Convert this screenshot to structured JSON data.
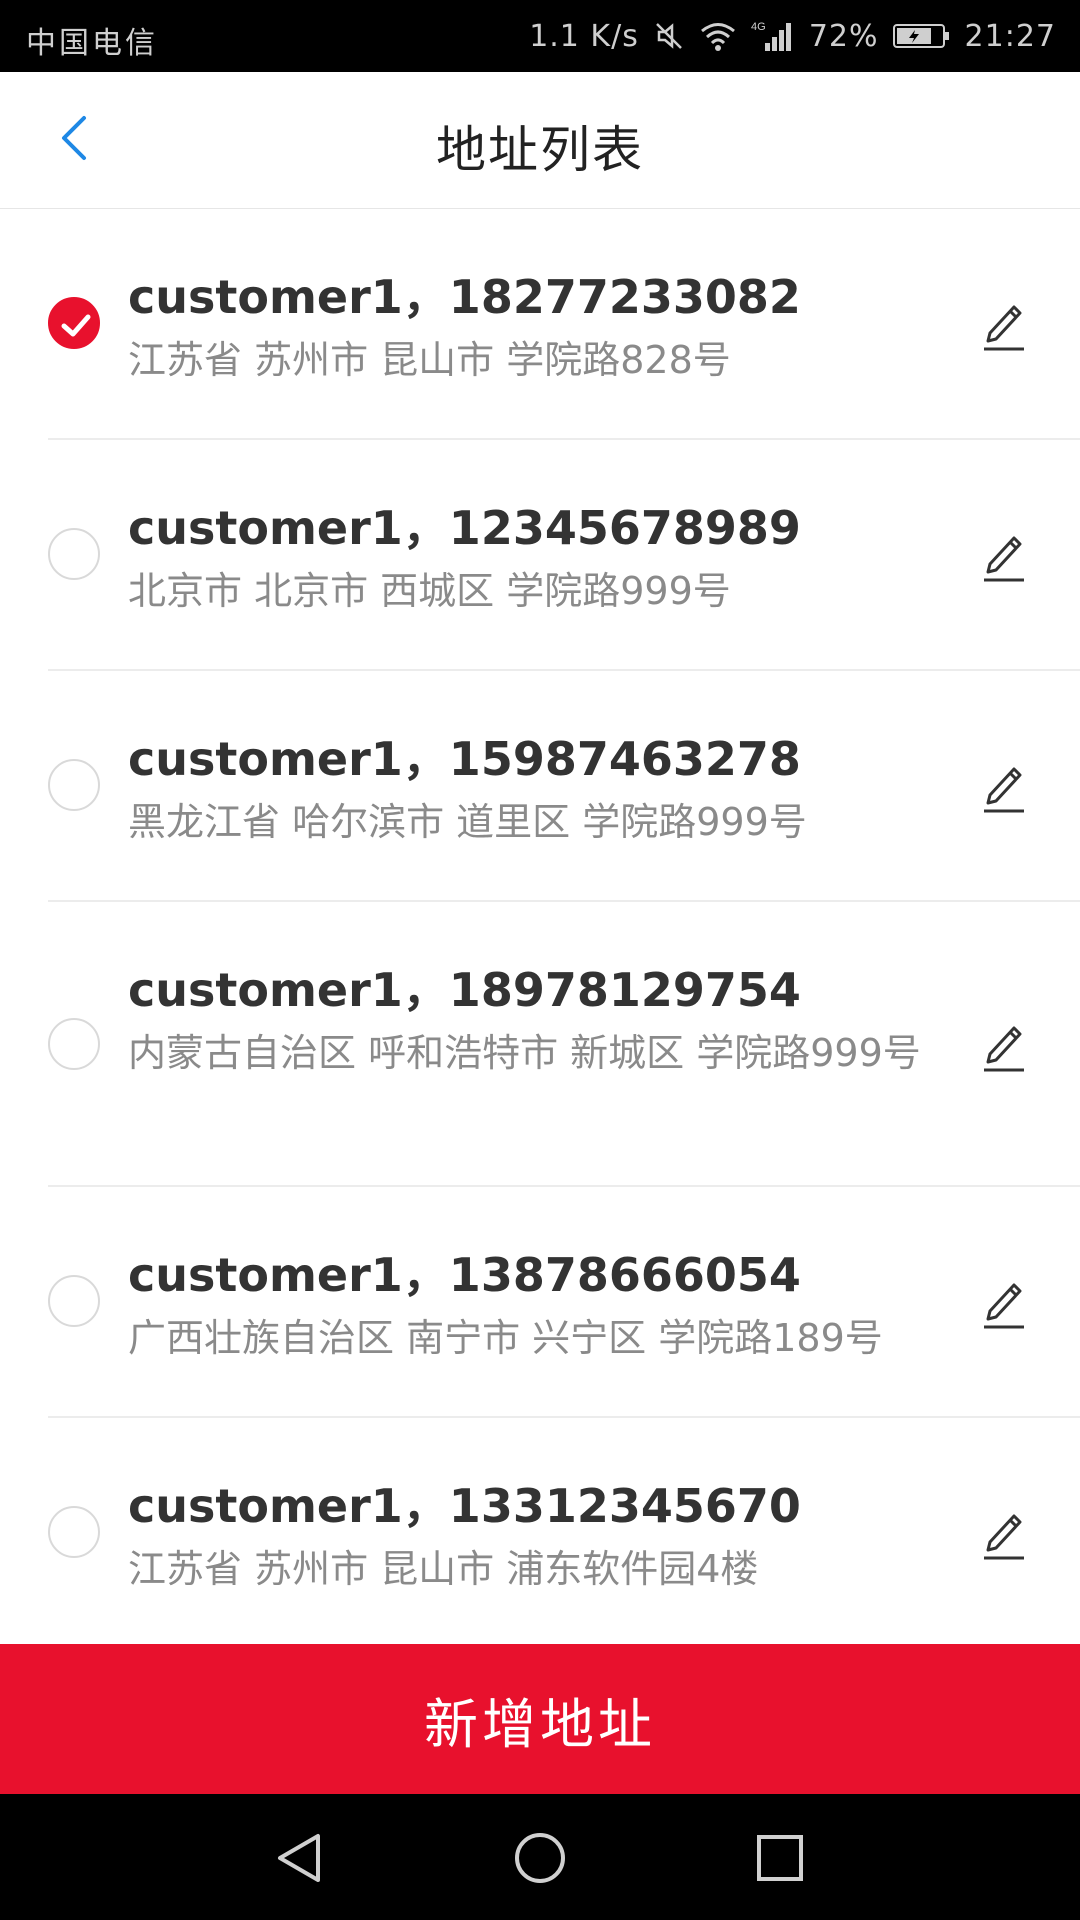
{
  "status_bar": {
    "carrier": "中国电信",
    "net_speed": "1.1 K/s",
    "battery": "72%",
    "time": "21:27"
  },
  "header": {
    "title": "地址列表",
    "back_icon": "chevron-left-icon"
  },
  "addresses": [
    {
      "contact": "customer1，18277233082",
      "address": "江苏省 苏州市 昆山市 学院路828号",
      "selected": true
    },
    {
      "contact": "customer1，12345678989",
      "address": "北京市 北京市 西城区 学院路999号",
      "selected": false
    },
    {
      "contact": "customer1，15987463278",
      "address": "黑龙江省 哈尔滨市 道里区 学院路999号",
      "selected": false
    },
    {
      "contact": "customer1，18978129754",
      "address": "内蒙古自治区 呼和浩特市 新城区 学院路999号",
      "selected": false
    },
    {
      "contact": "customer1，13878666054",
      "address": "广西壮族自治区 南宁市 兴宁区 学院路189号",
      "selected": false
    },
    {
      "contact": "customer1，13312345670",
      "address": "江苏省 苏州市 昆山市 浦东软件园4楼",
      "selected": false
    }
  ],
  "add_button": {
    "label": "新增地址"
  },
  "colors": {
    "accent": "#e8112d",
    "link_blue": "#1e88e5",
    "text_primary": "#333333",
    "text_secondary": "#8a8a8a"
  }
}
